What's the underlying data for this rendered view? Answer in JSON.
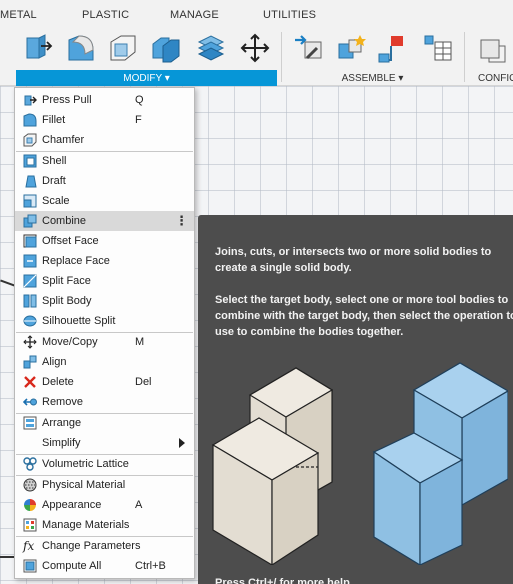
{
  "tabs": [
    "METAL",
    "PLASTIC",
    "MANAGE",
    "UTILITIES"
  ],
  "groups": {
    "modify": "MODIFY ▾",
    "assemble": "ASSEMBLE ▾",
    "configure": "CONFIG"
  },
  "menu": {
    "items": [
      {
        "label": "Press Pull",
        "shortcut": "Q"
      },
      {
        "label": "Fillet",
        "shortcut": "F"
      },
      {
        "label": "Chamfer",
        "shortcut": ""
      },
      {
        "label": "Shell",
        "shortcut": ""
      },
      {
        "label": "Draft",
        "shortcut": ""
      },
      {
        "label": "Scale",
        "shortcut": ""
      },
      {
        "label": "Combine",
        "shortcut": ""
      },
      {
        "label": "Offset Face",
        "shortcut": ""
      },
      {
        "label": "Replace Face",
        "shortcut": ""
      },
      {
        "label": "Split Face",
        "shortcut": ""
      },
      {
        "label": "Split Body",
        "shortcut": ""
      },
      {
        "label": "Silhouette Split",
        "shortcut": ""
      },
      {
        "label": "Move/Copy",
        "shortcut": "M"
      },
      {
        "label": "Align",
        "shortcut": ""
      },
      {
        "label": "Delete",
        "shortcut": "Del"
      },
      {
        "label": "Remove",
        "shortcut": ""
      },
      {
        "label": "Arrange",
        "shortcut": ""
      },
      {
        "label": "Simplify",
        "shortcut": ""
      },
      {
        "label": "Volumetric Lattice",
        "shortcut": ""
      },
      {
        "label": "Physical Material",
        "shortcut": ""
      },
      {
        "label": "Appearance",
        "shortcut": "A"
      },
      {
        "label": "Manage Materials",
        "shortcut": ""
      },
      {
        "label": "Change Parameters",
        "shortcut": ""
      },
      {
        "label": "Compute All",
        "shortcut": "Ctrl+B"
      }
    ],
    "more_glyph": "⋮"
  },
  "tooltip": {
    "p1": "Joins, cuts, or intersects two or more solid bodies to create a single solid body.",
    "p2": "Select the target body, select one or more tool bodies to combine with the target body, then select the operation to use to combine the bodies together.",
    "foot": "Press Ctrl+/ for more help."
  },
  "colors": {
    "accent": "#0696d7",
    "tooltip_bg": "#4d4d4d",
    "beige": "#e3ddd2",
    "blue": "#8fc0e3"
  }
}
